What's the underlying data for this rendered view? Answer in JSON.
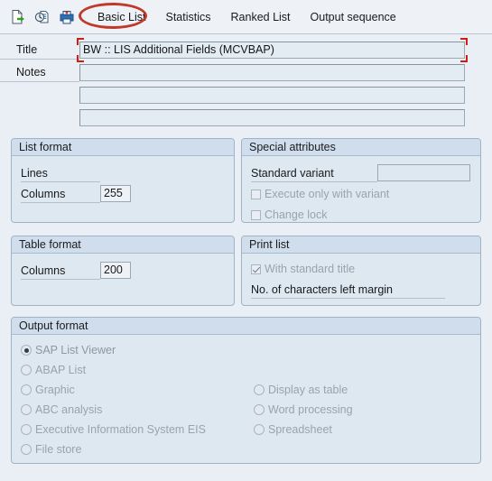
{
  "toolbar": {
    "icons": [
      {
        "name": "execute-document-icon",
        "title": "Execute"
      },
      {
        "name": "clock-document-icon",
        "title": "Background"
      },
      {
        "name": "print-network-icon",
        "title": "Print"
      }
    ],
    "tabs": [
      {
        "label": "Basic List",
        "active": true
      },
      {
        "label": "Statistics",
        "active": false
      },
      {
        "label": "Ranked List",
        "active": false
      },
      {
        "label": "Output sequence",
        "active": false
      }
    ],
    "annotation_color": "#c0392b"
  },
  "form": {
    "title_label": "Title",
    "title_value": "BW :: LIS Additional Fields (MCVBAP)",
    "notes_label": "Notes",
    "notes_values": [
      "",
      "",
      ""
    ]
  },
  "list_format": {
    "legend": "List format",
    "lines_label": "Lines",
    "lines_value": "",
    "columns_label": "Columns",
    "columns_value": "255"
  },
  "special_attributes": {
    "legend": "Special attributes",
    "standard_variant_label": "Standard variant",
    "standard_variant_value": "",
    "checkboxes": [
      {
        "label": "Execute only with variant",
        "checked": false,
        "disabled": true
      },
      {
        "label": "Change lock",
        "checked": false,
        "disabled": true
      }
    ]
  },
  "table_format": {
    "legend": "Table format",
    "columns_label": "Columns",
    "columns_value": "200"
  },
  "print_list": {
    "legend": "Print list",
    "with_standard_title": {
      "label": "With standard title",
      "checked": true,
      "disabled": true
    },
    "left_margin_label": "No. of characters left margin",
    "left_margin_value": ""
  },
  "output_format": {
    "legend": "Output format",
    "left_options": [
      {
        "label": "SAP List Viewer",
        "selected": true,
        "disabled": true
      },
      {
        "label": "ABAP List",
        "selected": false,
        "disabled": true
      },
      {
        "label": "Graphic",
        "selected": false,
        "disabled": true
      },
      {
        "label": "ABC analysis",
        "selected": false,
        "disabled": true
      },
      {
        "label": "Executive Information System EIS",
        "selected": false,
        "disabled": true
      },
      {
        "label": "File store",
        "selected": false,
        "disabled": true
      }
    ],
    "right_options": [
      {
        "label": "Display as table",
        "selected": false,
        "disabled": true
      },
      {
        "label": "Word processing",
        "selected": false,
        "disabled": true
      },
      {
        "label": "Spreadsheet",
        "selected": false,
        "disabled": true
      }
    ]
  }
}
